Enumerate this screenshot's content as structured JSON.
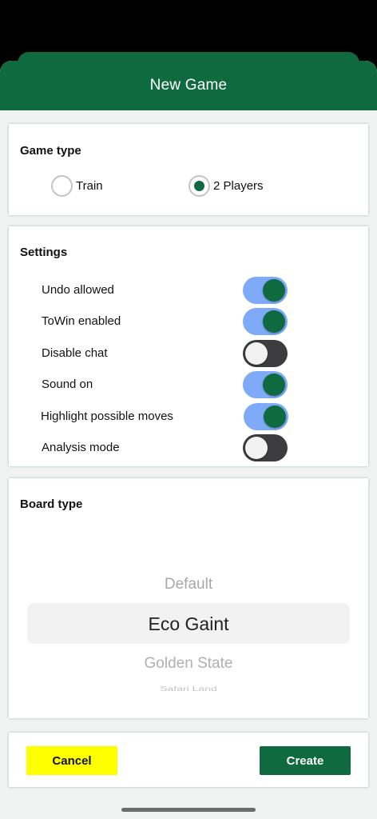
{
  "colors": {
    "brand_green": "#0f6b3f",
    "toggle_on_track": "#7eaaf8",
    "toggle_off_track": "#3c3c3e",
    "cancel_button": "#ffff00"
  },
  "header": {
    "title": "New Game"
  },
  "game_type": {
    "title": "Game type",
    "options": [
      {
        "label": "Train",
        "selected": false
      },
      {
        "label": "2 Players",
        "selected": true
      }
    ]
  },
  "settings": {
    "title": "Settings",
    "items": [
      {
        "label": "Undo allowed",
        "on": true
      },
      {
        "label": "ToWin enabled",
        "on": true
      },
      {
        "label": "Disable chat",
        "on": false
      },
      {
        "label": "Sound on",
        "on": true
      },
      {
        "label": "Highlight possible moves",
        "on": true
      },
      {
        "label": "Analysis mode",
        "on": false
      }
    ]
  },
  "board_type": {
    "title": "Board type",
    "options": [
      "Default",
      "Eco Gaint",
      "Golden State",
      "Safari Land"
    ],
    "selected": "Eco Gaint"
  },
  "actions": {
    "cancel_label": "Cancel",
    "create_label": "Create"
  }
}
